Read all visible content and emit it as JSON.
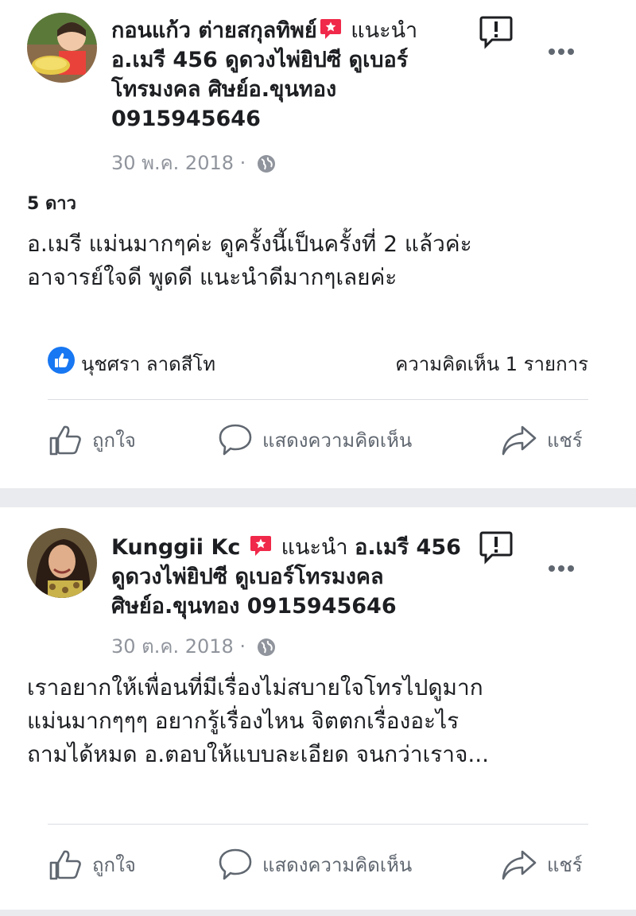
{
  "posts": [
    {
      "author": "กอนแก้ว ต่ายสกุลทิพย์",
      "recommends": "แนะนำ",
      "target_lines": [
        "อ.เมรี 456 ดูดวงไพ่ยิปซี ดูเบอร์",
        "โทรมงคล ศิษย์อ.ขุนทอง",
        "0915945646"
      ],
      "date": "30 พ.ค. 2018",
      "separator": "·",
      "rating": "5 ดาว",
      "body_lines": [
        "อ.เมรี แม่นมากๆค่ะ ดูครั้งนี้เป็นครั้งที่ 2 แล้วค่ะ",
        "อาจารย์ใจดี พูดดี แนะนำดีมากๆเลยค่ะ"
      ],
      "reactor": "นุชศรา ลาดสีโท",
      "comment_count": "ความคิดเห็น 1 รายการ",
      "actions": {
        "like": "ถูกใจ",
        "comment": "แสดงความคิดเห็น",
        "share": "แชร์"
      }
    },
    {
      "author": "Kunggii Kc",
      "recommends": "แนะนำ",
      "target_first": "อ.เมรี 456",
      "target_lines": [
        "ดูดวงไพ่ยิปซี ดูเบอร์โทรมงคล",
        "ศิษย์อ.ขุนทอง 0915945646"
      ],
      "date": "30 ต.ค. 2018",
      "separator": "·",
      "body_lines": [
        "เราอยากให้เพื่อนที่มีเรื่องไม่สบายใจโทรไปดูมาก",
        "แม่นมากๆๆๆ อยากรู้เรื่องไหน จิตตกเรื่องอะไร",
        "ถามได้หมด อ.ตอบให้แบบละเอียด จนกว่าเราจ..."
      ],
      "actions": {
        "like": "ถูกใจ",
        "comment": "แสดงความคิดเห็น",
        "share": "แชร์"
      }
    }
  ],
  "colors": {
    "recommend_badge": "#f02849",
    "like_blue": "#1877f2",
    "meta_gray": "#90949c",
    "action_gray": "#606770",
    "separator_band": "#e9ebee"
  },
  "icons": [
    "recommend-badge-icon",
    "report-icon",
    "more-options-icon",
    "globe-icon",
    "like-reaction-icon",
    "thumbs-up-icon",
    "comment-bubble-icon",
    "share-arrow-icon"
  ]
}
